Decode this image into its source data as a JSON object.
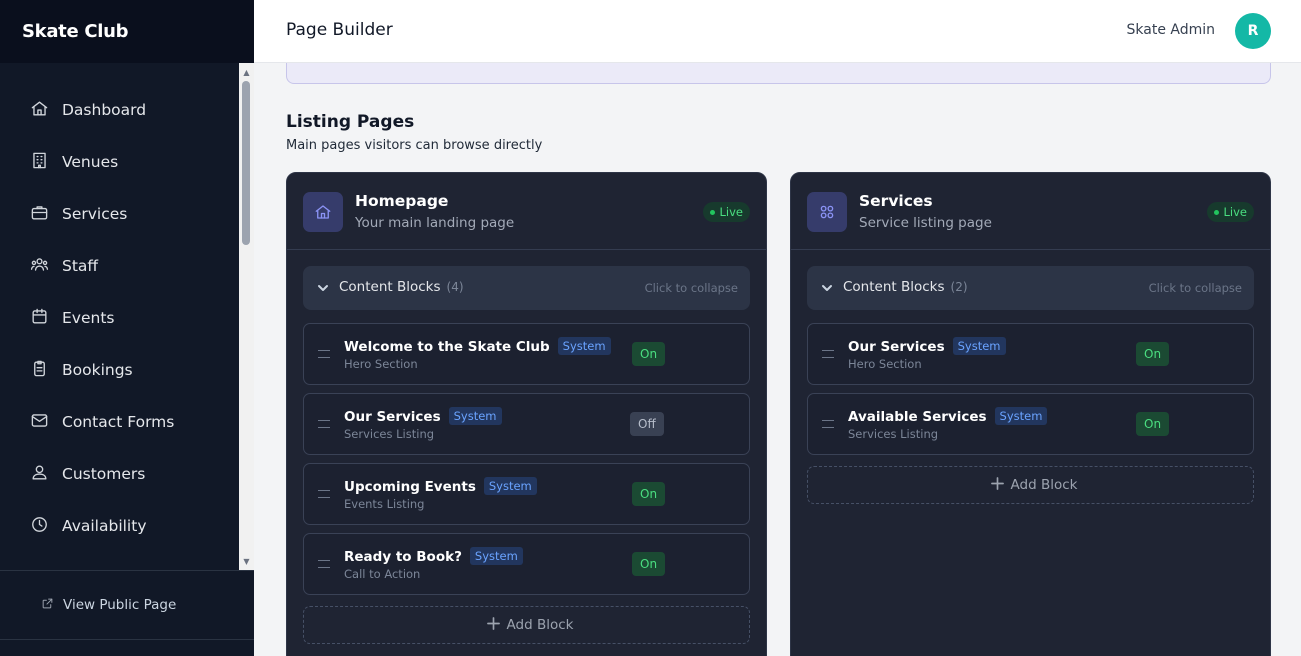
{
  "app": {
    "brand": "Skate Club"
  },
  "sidebar": {
    "items": [
      {
        "label": "Dashboard",
        "icon": "home-icon"
      },
      {
        "label": "Venues",
        "icon": "building-icon"
      },
      {
        "label": "Services",
        "icon": "briefcase-icon"
      },
      {
        "label": "Staff",
        "icon": "users-icon"
      },
      {
        "label": "Events",
        "icon": "calendar-icon"
      },
      {
        "label": "Bookings",
        "icon": "clipboard-icon"
      },
      {
        "label": "Contact Forms",
        "icon": "mail-icon"
      },
      {
        "label": "Customers",
        "icon": "user-group-icon"
      },
      {
        "label": "Availability",
        "icon": "clock-icon"
      }
    ],
    "footer_link": "View Public Page"
  },
  "header": {
    "title": "Page Builder",
    "user_name": "Skate Admin",
    "avatar_initial": "R"
  },
  "section": {
    "title": "Listing Pages",
    "subtitle": "Main pages visitors can browse directly"
  },
  "cards": [
    {
      "title": "Homepage",
      "subtitle": "Your main landing page",
      "status": "Live",
      "blocks_label": "Content Blocks",
      "blocks_count": "(4)",
      "collapse_hint": "Click to collapse",
      "blocks": [
        {
          "name": "Welcome to the Skate Club",
          "badge": "System",
          "type": "Hero Section",
          "toggle": "On"
        },
        {
          "name": "Our Services",
          "badge": "System",
          "type": "Services Listing",
          "toggle": "Off"
        },
        {
          "name": "Upcoming Events",
          "badge": "System",
          "type": "Events Listing",
          "toggle": "On"
        },
        {
          "name": "Ready to Book?",
          "badge": "System",
          "type": "Call to Action",
          "toggle": "On"
        }
      ],
      "add_label": "Add Block"
    },
    {
      "title": "Services",
      "subtitle": "Service listing page",
      "status": "Live",
      "blocks_label": "Content Blocks",
      "blocks_count": "(2)",
      "collapse_hint": "Click to collapse",
      "blocks": [
        {
          "name": "Our Services",
          "badge": "System",
          "type": "Hero Section",
          "toggle": "On"
        },
        {
          "name": "Available Services",
          "badge": "System",
          "type": "Services Listing",
          "toggle": "On"
        }
      ],
      "add_label": "Add Block"
    }
  ],
  "colors": {
    "sidebar_bg": "#111827",
    "accent": "#14b8a6",
    "live_green": "#4ade80",
    "system_blue": "#6aa3ff"
  }
}
